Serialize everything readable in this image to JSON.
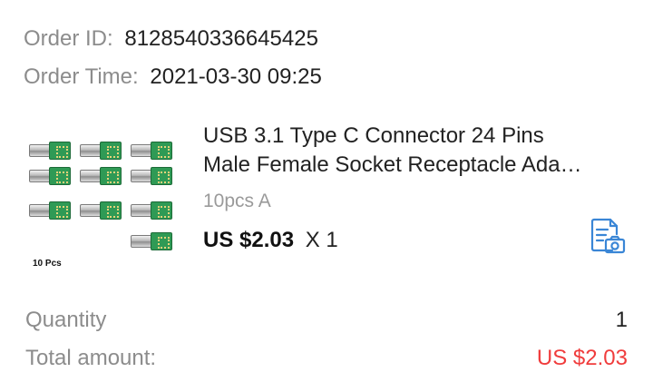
{
  "order": {
    "id_label": "Order ID:",
    "id_value": "8128540336645425",
    "time_label": "Order Time:",
    "time_value": "2021-03-30 09:25"
  },
  "product": {
    "title_line1": "USB 3.1 Type C Connector 24 Pins",
    "title_line2": "Male Female Socket Receptacle Ada…",
    "image_caption": "10 Pcs",
    "sku": "10pcs A",
    "price": "US $2.03",
    "quantity_multiplier": "X 1",
    "snapshot_icon": "document-camera-icon",
    "accent_color": "#3a86d6"
  },
  "summary": {
    "quantity_label": "Quantity",
    "quantity_value": "1",
    "total_label": "Total amount:",
    "total_value": "US $2.03",
    "total_color": "#f03c3c"
  }
}
